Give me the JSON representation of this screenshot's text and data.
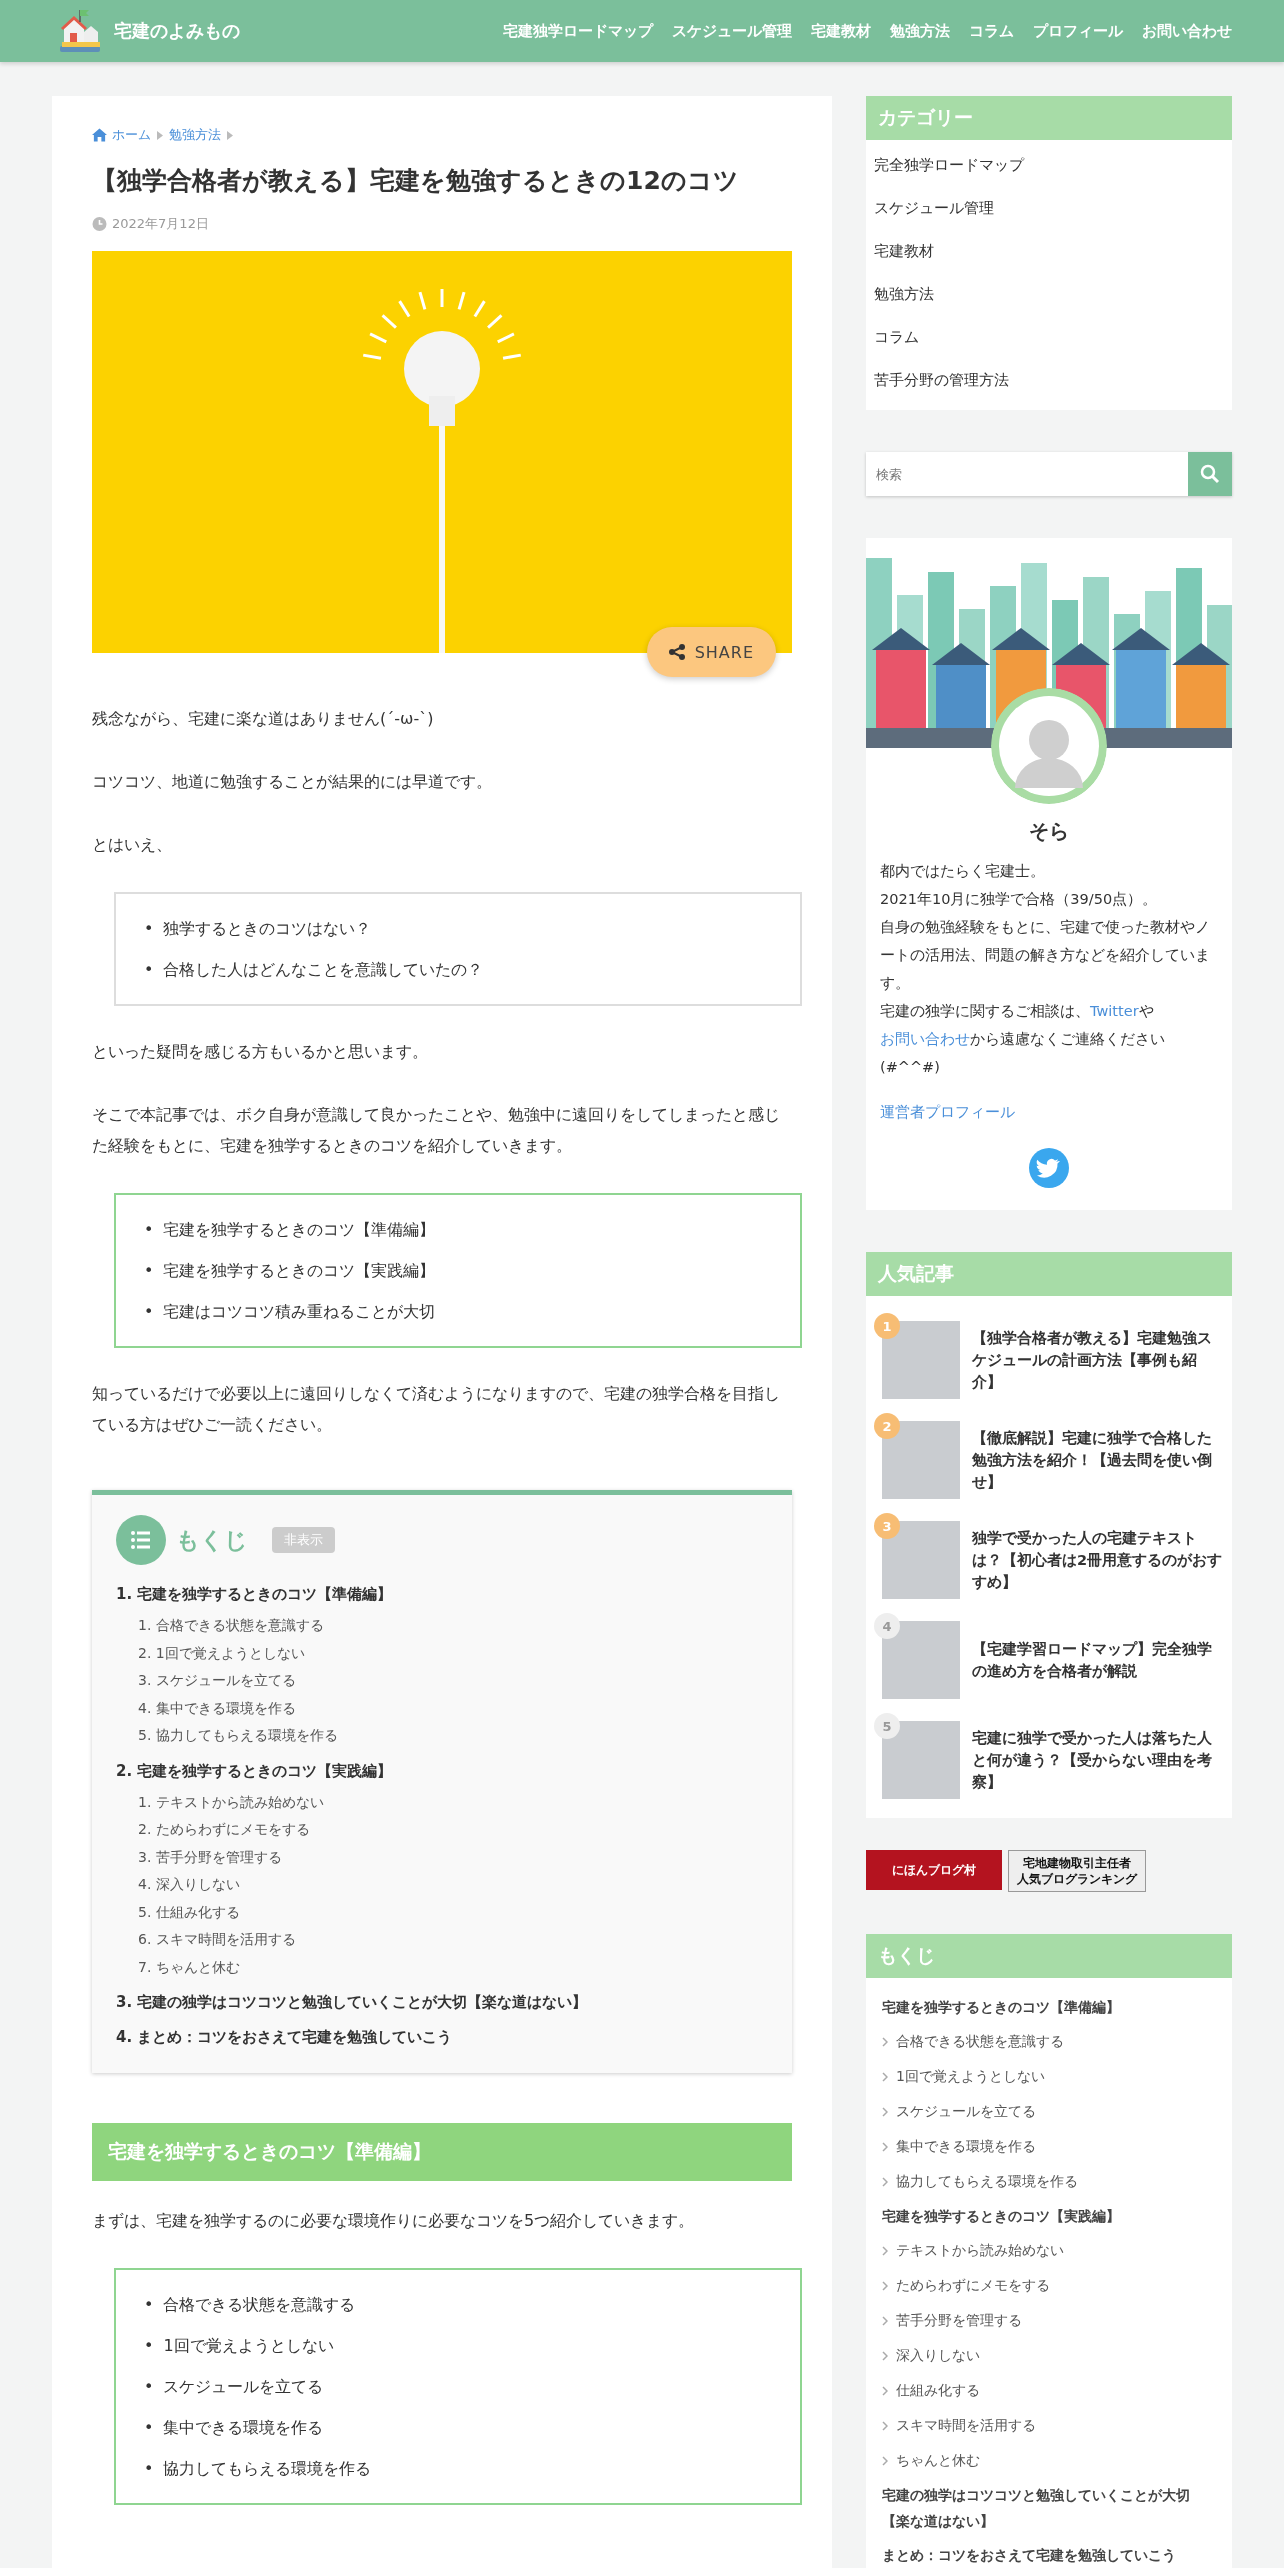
{
  "header": {
    "site_title": "宅建のよみもの",
    "nav": [
      {
        "label": "宅建独学ロードマップ"
      },
      {
        "label": "スケジュール管理"
      },
      {
        "label": "宅建教材"
      },
      {
        "label": "勉強方法"
      },
      {
        "label": "コラム"
      },
      {
        "label": "プロフィール"
      },
      {
        "label": "お問い合わせ"
      }
    ]
  },
  "article": {
    "breadcrumb": [
      {
        "label": "ホーム",
        "kind": "home"
      },
      {
        "label": "勉強方法",
        "kind": "category"
      }
    ],
    "title": "【独学合格者が教える】宅建を勉強するときの12のコツ",
    "date": "2022年7月12日",
    "share_button": "SHARE",
    "blocks": [
      {
        "kind": "paragraph",
        "text": "残念ながら、宅建に楽な道はありません(´-ω-`)"
      },
      {
        "kind": "paragraph",
        "text": "コツコツ、地道に勉強することが結果的には早道です。"
      },
      {
        "kind": "paragraph",
        "text": "とはいえ、"
      },
      {
        "kind": "list",
        "accent": false,
        "marker": "•",
        "items": [
          "独学するときのコツはない？",
          "合格した人はどんなことを意識していたの？"
        ]
      },
      {
        "kind": "paragraph",
        "text": "といった疑問を感じる方もいるかと思います。"
      },
      {
        "kind": "paragraph",
        "text": "そこで本記事では、ボク自身が意識して良かったことや、勉強中に遠回りをしてしまったと感じた経験をもとに、宅建を独学するときのコツを紹介していきます。"
      },
      {
        "kind": "list",
        "accent": true,
        "marker": "•",
        "items": [
          "宅建を独学するときのコツ【準備編】",
          "宅建を独学するときのコツ【実践編】",
          "宅建はコツコツ積み重ねることが大切"
        ]
      },
      {
        "kind": "paragraph",
        "text": "知っているだけで必要以上に遠回りしなくて済むようになりますので、宅建の独学合格を目指している方はぜひご一読ください。"
      },
      {
        "kind": "toc",
        "title": "もくじ",
        "toggle": "非表示",
        "items": [
          {
            "number": "1.",
            "label": "宅建を独学するときのコツ【準備編】",
            "children": [
              {
                "number": "1.",
                "label": "合格できる状態を意識する"
              },
              {
                "number": "2.",
                "label": "1回で覚えようとしない"
              },
              {
                "number": "3.",
                "label": "スケジュールを立てる"
              },
              {
                "number": "4.",
                "label": "集中できる環境を作る"
              },
              {
                "number": "5.",
                "label": "協力してもらえる環境を作る"
              }
            ]
          },
          {
            "number": "2.",
            "label": "宅建を独学するときのコツ【実践編】",
            "children": [
              {
                "number": "1.",
                "label": "テキストから読み始めない"
              },
              {
                "number": "2.",
                "label": "ためらわずにメモをする"
              },
              {
                "number": "3.",
                "label": "苦手分野を管理する"
              },
              {
                "number": "4.",
                "label": "深入りしない"
              },
              {
                "number": "5.",
                "label": "仕組み化する"
              },
              {
                "number": "6.",
                "label": "スキマ時間を活用する"
              },
              {
                "number": "7.",
                "label": "ちゃんと休む"
              }
            ]
          },
          {
            "number": "3.",
            "label": "宅建の独学はコツコツと勉強していくことが大切【楽な道はない】"
          },
          {
            "number": "4.",
            "label": "まとめ：コツをおさえて宅建を勉強していこう"
          }
        ]
      },
      {
        "kind": "heading",
        "text": "宅建を独学するときのコツ【準備編】"
      },
      {
        "kind": "paragraph",
        "text": "まずは、宅建を独学するのに必要な環境作りに必要なコツを5つ紹介していきます。"
      },
      {
        "kind": "list",
        "accent": true,
        "marker": "•",
        "items": [
          "合格できる状態を意識する",
          "1回で覚えようとしない",
          "スケジュールを立てる",
          "集中できる環境を作る",
          "協力してもらえる環境を作る"
        ]
      }
    ]
  },
  "sidebar": {
    "categories": {
      "title": "カテゴリー",
      "items": [
        {
          "label": "完全独学ロードマップ"
        },
        {
          "label": "スケジュール管理"
        },
        {
          "label": "宅建教材"
        },
        {
          "label": "勉強方法"
        },
        {
          "label": "コラム"
        },
        {
          "label": "苦手分野の管理方法"
        }
      ]
    },
    "search": {
      "placeholder": "検索"
    },
    "profile": {
      "name": "そら",
      "bio": [
        [
          {
            "text": "都内ではたらく宅建士。"
          }
        ],
        [
          {
            "text": "2021年10月に独学で合格（39/50点）。"
          }
        ],
        [
          {
            "text": "自身の勉強経験をもとに、宅建で使った教材やノートの活用法、問題の解き方などを紹介しています。"
          }
        ],
        [
          {
            "text": "宅建の独学に関するご相談は、"
          },
          {
            "link": "Twitter"
          },
          {
            "text": "や"
          },
          {
            "link": "お問い合わせ"
          },
          {
            "text": "から遠慮なくご連絡ください(#^^#)"
          }
        ]
      ],
      "profile_link": "運営者プロフィール"
    },
    "popular": {
      "title": "人気記事",
      "items": [
        {
          "rank": "1",
          "color": "#f7bd74",
          "title": "【独学合格者が教える】宅建勉強スケジュールの計画方法【事例も紹介】"
        },
        {
          "rank": "2",
          "color": "#f7bd74",
          "title": "【徹底解説】宅建に独学で合格した勉強方法を紹介！【過去問を使い倒せ】"
        },
        {
          "rank": "3",
          "color": "#f7bd74",
          "title": "独学で受かった人の宅建テキストは？【初心者は2冊用意するのがおすすめ】"
        },
        {
          "rank": "4",
          "color": "#eeeeee",
          "title": "【宅建学習ロードマップ】完全独学の進め方を合格者が解説"
        },
        {
          "rank": "5",
          "color": "#eeeeee",
          "title": "宅建に独学で受かった人は落ちた人と何が違う？【受からない理由を考察】"
        }
      ]
    },
    "banners": [
      {
        "lines": [
          "にほんブログ村"
        ],
        "kind": "red"
      },
      {
        "lines": [
          "宅地建物取引主任者",
          "人気ブログランキング"
        ],
        "kind": "light"
      }
    ],
    "toc": {
      "title": "もくじ",
      "items": [
        {
          "label": "宅建を独学するときのコツ【準備編】",
          "children": [
            {
              "label": "合格できる状態を意識する"
            },
            {
              "label": "1回で覚えようとしない"
            },
            {
              "label": "スケジュールを立てる"
            },
            {
              "label": "集中できる環境を作る"
            },
            {
              "label": "協力してもらえる環境を作る"
            }
          ]
        },
        {
          "label": "宅建を独学するときのコツ【実践編】",
          "children": [
            {
              "label": "テキストから読み始めない"
            },
            {
              "label": "ためらわずにメモをする"
            },
            {
              "label": "苦手分野を管理する"
            },
            {
              "label": "深入りしない"
            },
            {
              "label": "仕組み化する"
            },
            {
              "label": "スキマ時間を活用する"
            },
            {
              "label": "ちゃんと休む"
            }
          ]
        },
        {
          "label": "宅建の独学はコツコツと勉強していくことが大切【楽な道はない】"
        },
        {
          "label": "まとめ：コツをおさえて宅建を勉強していこう"
        }
      ]
    }
  }
}
